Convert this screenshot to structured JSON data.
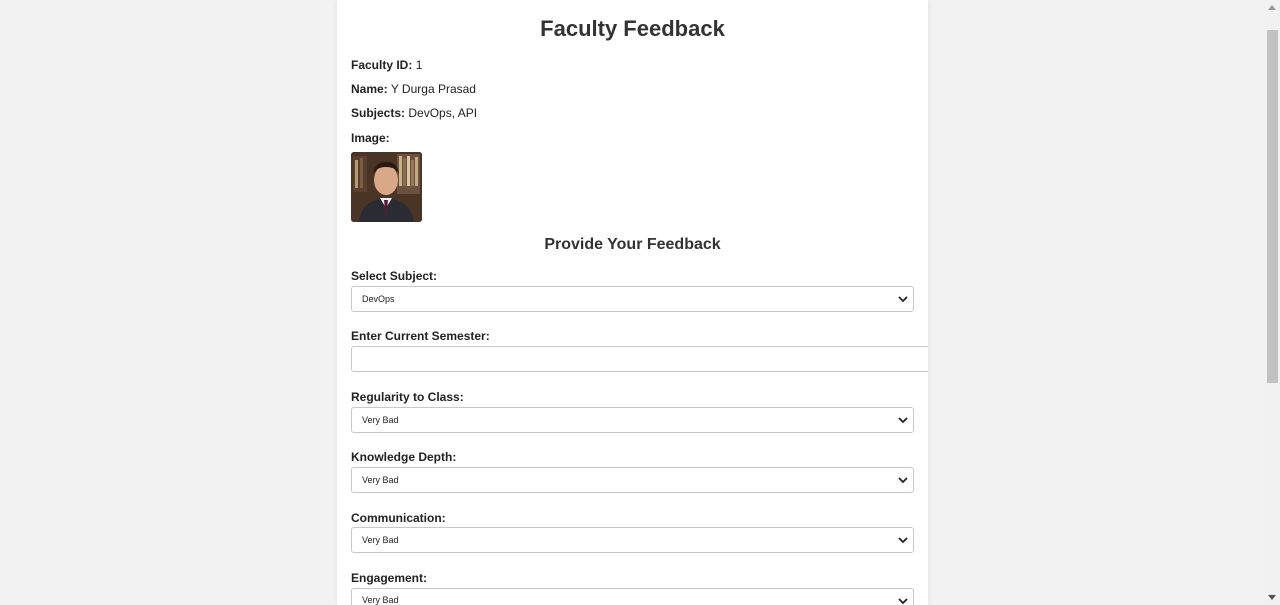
{
  "page": {
    "title": "Faculty Feedback",
    "feedback_heading": "Provide Your Feedback"
  },
  "faculty": {
    "id_label": "Faculty ID:",
    "id_value": "1",
    "name_label": "Name:",
    "name_value": "Y Durga Prasad",
    "subjects_label": "Subjects:",
    "subjects_value": "DevOps, API",
    "image_label": "Image:"
  },
  "form": {
    "subject": {
      "label": "Select Subject:",
      "value": "DevOps"
    },
    "semester": {
      "label": "Enter Current Semester:",
      "value": ""
    },
    "regularity": {
      "label": "Regularity to Class:",
      "value": "Very Bad"
    },
    "knowledge": {
      "label": "Knowledge Depth:",
      "value": "Very Bad"
    },
    "communication": {
      "label": "Communication:",
      "value": "Very Bad"
    },
    "engagement": {
      "label": "Engagement:",
      "value": "Very Bad"
    }
  },
  "colors": {
    "background": "#f2f2f2",
    "card": "#ffffff",
    "heading": "#333333"
  }
}
